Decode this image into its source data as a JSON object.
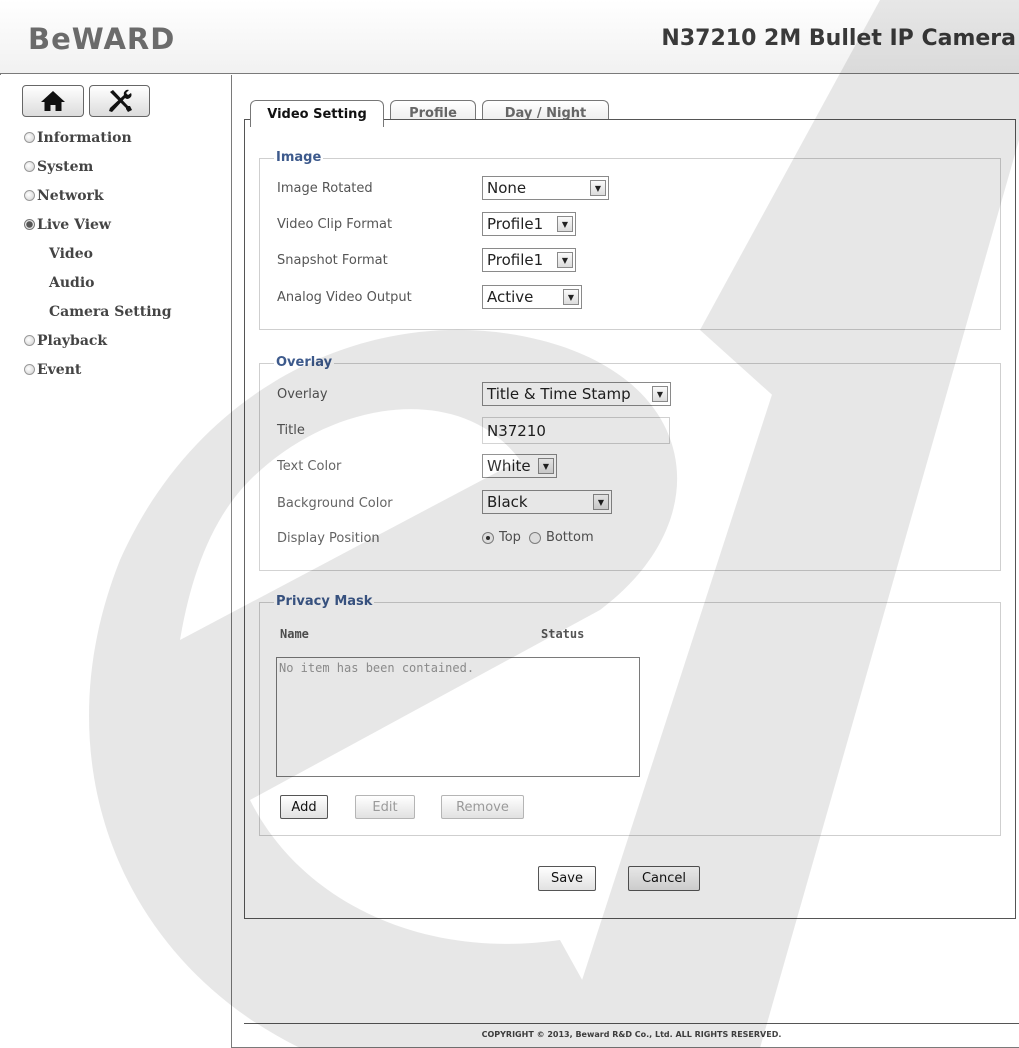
{
  "header": {
    "logo": "BeWARD",
    "camera_title": "N37210 2M Bullet IP Camera"
  },
  "sidebar": {
    "home_icon": "home-icon",
    "tools_icon": "tools-icon",
    "items": [
      {
        "label": "Information",
        "expanded": false
      },
      {
        "label": "System",
        "expanded": false
      },
      {
        "label": "Network",
        "expanded": false
      },
      {
        "label": "Live View",
        "expanded": true,
        "children": [
          "Video",
          "Audio",
          "Camera Setting"
        ]
      },
      {
        "label": "Playback",
        "expanded": false
      },
      {
        "label": "Event",
        "expanded": false
      }
    ]
  },
  "tabs": [
    {
      "label": "Video Setting",
      "active": true
    },
    {
      "label": "Profile",
      "active": false
    },
    {
      "label": "Day / Night",
      "active": false
    }
  ],
  "image": {
    "legend": "Image",
    "rows": [
      {
        "label": "Image Rotated",
        "value": "None"
      },
      {
        "label": "Video Clip Format",
        "value": "Profile1"
      },
      {
        "label": "Snapshot Format",
        "value": "Profile1"
      },
      {
        "label": "Analog Video Output",
        "value": "Active"
      }
    ]
  },
  "overlay": {
    "legend": "Overlay",
    "overlay_label": "Overlay",
    "overlay_value": "Title & Time Stamp",
    "title_label": "Title",
    "title_value": "N37210",
    "text_color_label": "Text Color",
    "text_color_value": "White",
    "bg_color_label": "Background Color",
    "bg_color_value": "Black",
    "position_label": "Display Position",
    "position_top": "Top",
    "position_bottom": "Bottom",
    "position_selected": "Top"
  },
  "privacy": {
    "legend": "Privacy Mask",
    "col_name": "Name",
    "col_status": "Status",
    "empty_text": "No item has been contained.",
    "add": "Add",
    "edit": "Edit",
    "remove": "Remove"
  },
  "actions": {
    "save": "Save",
    "cancel": "Cancel"
  },
  "footer": {
    "copyright": "COPYRIGHT © 2013, Beward R&D Co., Ltd. ALL RIGHTS RESERVED."
  },
  "colors": {
    "legend": "#3d5a8c",
    "border": "#7a7a7a"
  }
}
